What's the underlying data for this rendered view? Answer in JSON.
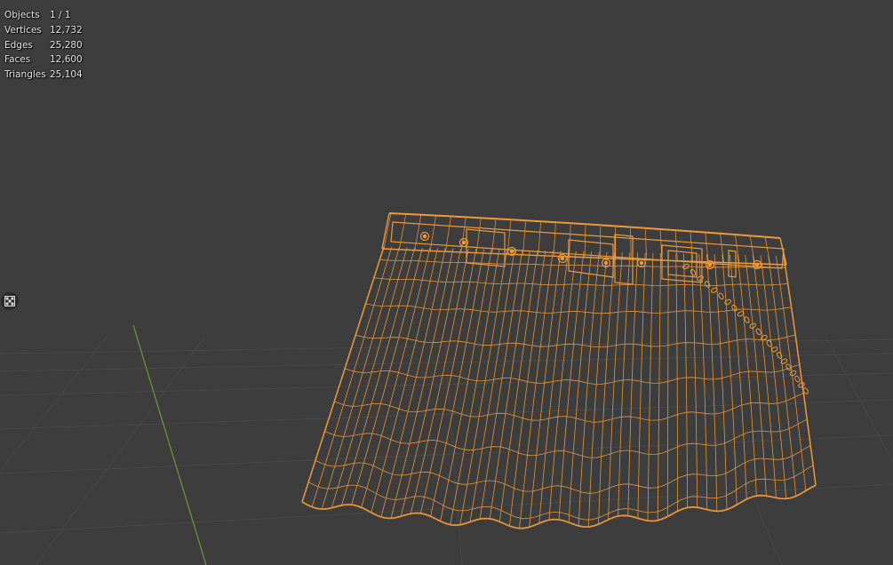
{
  "stats": [
    {
      "label": "Objects",
      "value": "1 / 1"
    },
    {
      "label": "Vertices",
      "value": "12,732"
    },
    {
      "label": "Edges",
      "value": "25,280"
    },
    {
      "label": "Faces",
      "value": "12,600"
    },
    {
      "label": "Triangles",
      "value": "25,104"
    }
  ],
  "colors": {
    "background": "#3d3d3d",
    "grid": "#4a4a4a",
    "axis_y": "#6a9a3a",
    "wire": "#ee9a3c"
  },
  "icons": {
    "side_toggle": "checkerboard-icon"
  }
}
